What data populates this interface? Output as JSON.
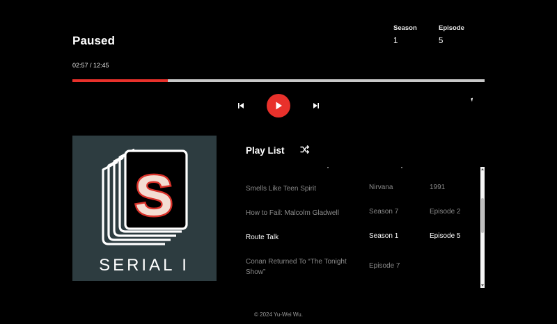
{
  "player": {
    "status": "Paused",
    "time": "02:57 / 12:45",
    "progress_fraction": 0.232,
    "season_label": "Season",
    "season_value": "1",
    "episode_label": "Episode",
    "episode_value": "5"
  },
  "colors": {
    "accent": "#e8312b",
    "cover_bg": "#2d3c40",
    "track": "#c8c8c8"
  },
  "controls": {
    "prev_icon": "skip-previous-icon",
    "play_icon": "play-icon",
    "next_icon": "skip-next-icon"
  },
  "cover": {
    "title": "SERIAL I",
    "logo_letter": "S"
  },
  "playlist": {
    "title": "Play List",
    "shuffle_icon": "shuffle-icon",
    "rows": [
      {
        "title": "Smells Like Teen Spirit",
        "col2": "Nirvana",
        "col3": "1991",
        "active": false
      },
      {
        "title": "How to Fail: Malcolm Gladwell",
        "col2": "Season 7",
        "col3": "Episode 2",
        "active": false
      },
      {
        "title": "Route Talk",
        "col2": "Season 1",
        "col3": "Episode 5",
        "active": true
      },
      {
        "title": "Conan Returned To “The Tonight Show”",
        "col2": "Episode 7",
        "col3": "",
        "active": false
      }
    ]
  },
  "footer": "© 2024 Yu-Wei Wu."
}
